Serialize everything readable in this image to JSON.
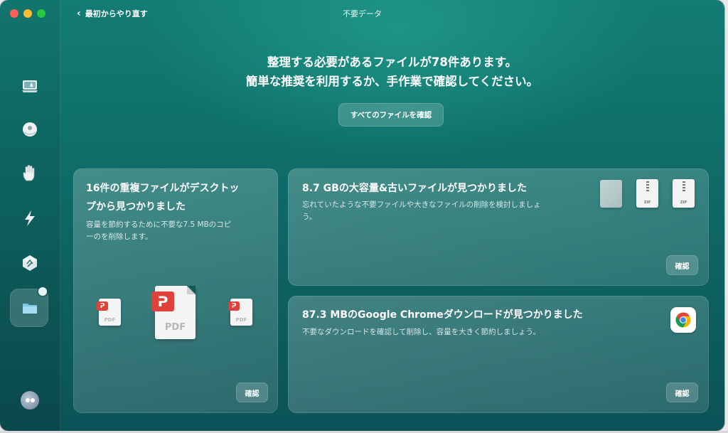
{
  "window": {
    "title": "不要データ",
    "back_label": "最初からやり直す"
  },
  "headline": {
    "line1": "整理する必要があるファイルが78件あります。",
    "line2": "簡単な推奨を利用するか、手作業で確認してください。"
  },
  "review_all_label": "すべてのファイルを確認",
  "cards": {
    "duplicates": {
      "title_line1": "16件の重複ファイルがデスクトッ",
      "title_line2": "プから見つかりました",
      "desc_line1": "容量を節約するために不要な7.5 MBのコピ",
      "desc_line2": "ーのを削除します。",
      "confirm_label": "確認",
      "pdf_label": "PDF"
    },
    "large_files": {
      "title": "8.7 GBの大容量&古いファイルが見つかりました",
      "desc_line1": "忘れていたような不要ファイルや大きなファイルの削除を検討しましょ",
      "desc_line2": "う。",
      "confirm_label": "確認",
      "zip_label": "ZIP"
    },
    "chrome_downloads": {
      "title": "87.3 MBのGoogle Chromeダウンロードが見つかりました",
      "desc": "不要なダウンロードを確認して削除し、容量を大きく節約しましょう。",
      "confirm_label": "確認"
    }
  },
  "sidebar": {
    "items": [
      {
        "icon": "cleanup-icon"
      },
      {
        "icon": "protection-icon"
      },
      {
        "icon": "privacy-hand-icon"
      },
      {
        "icon": "performance-icon"
      },
      {
        "icon": "applications-icon"
      },
      {
        "icon": "my-clutter-folder-icon",
        "active": true
      }
    ],
    "avatar_icon": "assistant-icon"
  },
  "colors": {
    "background_top": "#137c74",
    "background_bottom": "#0b5257",
    "pdf_red": "#e0413a",
    "traffic_close": "#ff5f57",
    "traffic_min": "#febc2e",
    "traffic_max": "#28c840"
  }
}
